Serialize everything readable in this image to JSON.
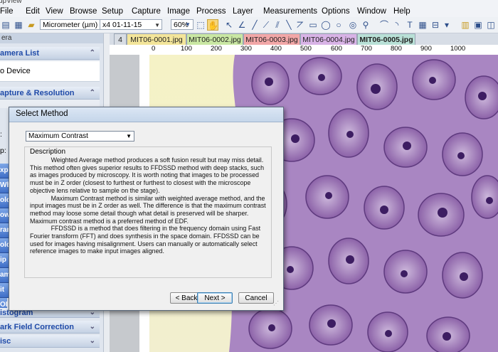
{
  "app": {
    "title_fragment": "dpView"
  },
  "menu": [
    "File",
    "Edit",
    "View",
    "Browse",
    "Setup",
    "Capture",
    "Image",
    "Process",
    "Layer",
    "Measurements",
    "Options",
    "Window",
    "Help"
  ],
  "toolbar": {
    "unit_select": "Micrometer (µm)",
    "calibration_select": "x4 01-11-15",
    "zoom_select": "60%"
  },
  "left_panel": {
    "header": "era",
    "sections": [
      {
        "label": "amera List",
        "items": [
          "o Device"
        ]
      },
      {
        "label": "apture & Resolution",
        "items": []
      }
    ],
    "side_buttons": [
      "xpo",
      "Whit",
      "olo",
      "owe",
      "ram",
      "olo",
      "ip",
      "amp",
      "it D",
      "OI",
      "istogram"
    ],
    "bottom_sections": [
      "ark Field Correction",
      "isc"
    ]
  },
  "tabs": [
    {
      "label": "4",
      "color": "#d8dde4"
    },
    {
      "label": "MIT06-0001.jpg",
      "color": "#f3e59a"
    },
    {
      "label": "MIT06-0002.jpg",
      "color": "#c9e7a3"
    },
    {
      "label": "MIT06-0003.jpg",
      "color": "#f2a7a7"
    },
    {
      "label": "MIT06-0004.jpg",
      "color": "#d8b3e6"
    },
    {
      "label": "MIT06-0005.jpg",
      "color": "#b8e0d6"
    }
  ],
  "ruler": {
    "labels": [
      "0",
      "100",
      "200",
      "300",
      "400",
      "500",
      "600",
      "700",
      "800",
      "900",
      "1000"
    ]
  },
  "dialog": {
    "title": "Select Method",
    "method": "Maximum Contrast",
    "description_label": "Description",
    "description": "            Weighted Average method produces a soft fusion result but may miss detail. This method often gives superior results to FFDSSD method with deep stacks, such as images produced by microscopy. It is worth noting that images to be processed must be in Z order (closest to furthest or furthest to closest with the microscope objective lens relative to sample on the stage).\n            Maximum Contrast method is similar with weighted average method, and the input images must be in Z order as well. The difference is that the maximum contrast method may loose some detail though what detail is preserved will be sharper. Maximum contrast method is a preferred method of EDF.\n            FFDSSD is a method that does filtering in the frequency domain using Fast Fourier transform (FFT) and does synthesis in the space domain. FFDSSD can be used for images having misalignment. Users can manually or automatically select reference images to make input images aligned.",
    "buttons": {
      "back": "< Back",
      "next": "Next >",
      "cancel": "Cancel"
    },
    "side_labels": [
      ":",
      "p:"
    ]
  }
}
